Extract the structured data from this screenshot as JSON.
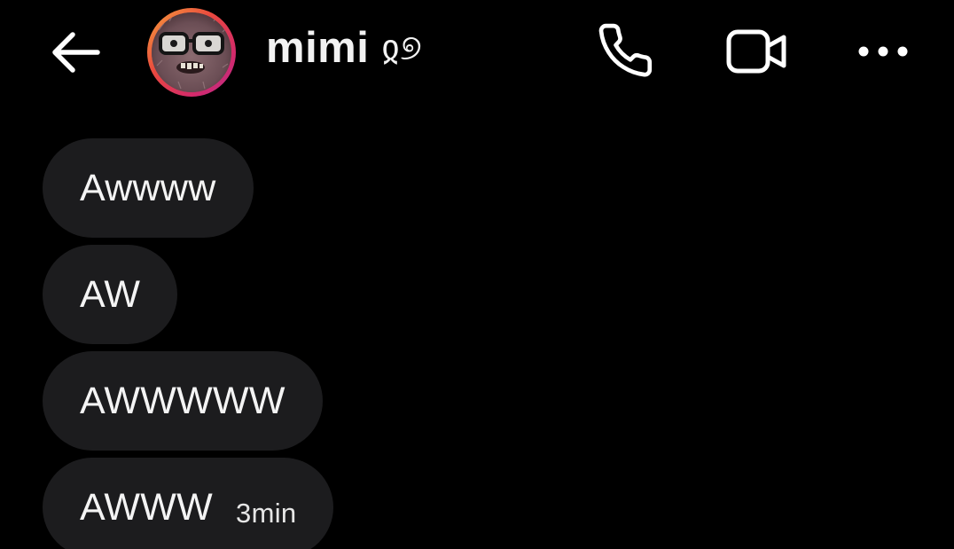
{
  "header": {
    "back_icon": "arrow-left-icon",
    "avatar_icon": "profile-photo",
    "contact_name": "mimi",
    "contact_name_suffix": "ჲ୭",
    "phone_icon": "phone-icon",
    "video_icon": "video-camera-icon",
    "more_icon": "more-horizontal-icon"
  },
  "messages": [
    {
      "text": "Awwww",
      "time": ""
    },
    {
      "text": "AW",
      "time": ""
    },
    {
      "text": "AWWWWW",
      "time": ""
    },
    {
      "text": "AWWW",
      "time": "3min"
    }
  ],
  "colors": {
    "background": "#000000",
    "bubble": "#1c1c1e",
    "text": "#f4f4f4",
    "story_ring_start": "#f7a23b",
    "story_ring_end": "#b52c8c"
  }
}
